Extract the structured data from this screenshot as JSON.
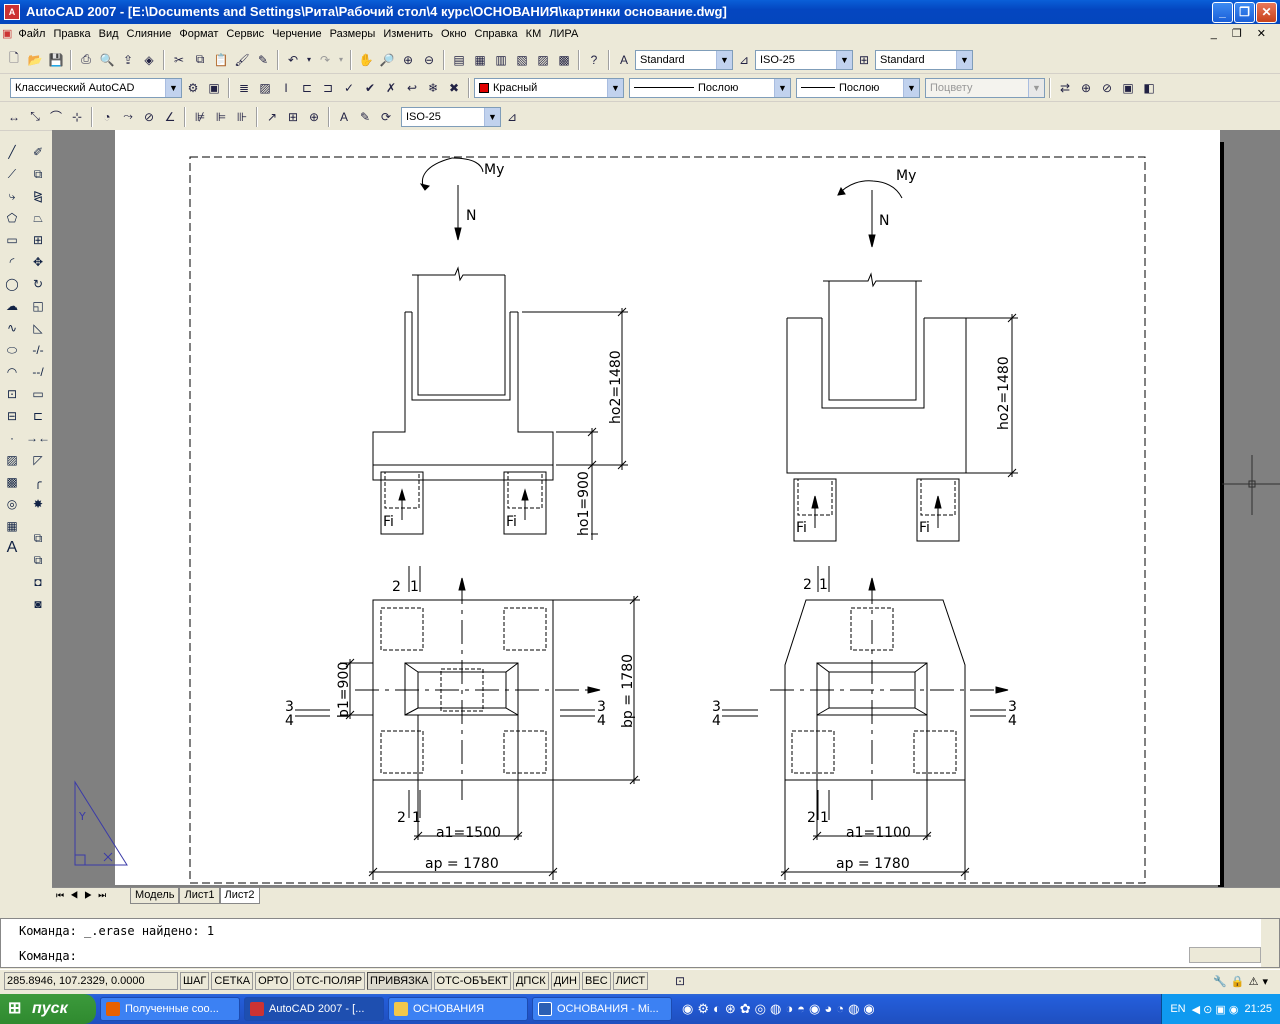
{
  "window": {
    "title": "AutoCAD 2007 - [E:\\Documents and Settings\\Рита\\Рабочий стол\\4 курс\\ОСНОВАНИЯ\\картинки основание.dwg]"
  },
  "menu": [
    "Файл",
    "Правка",
    "Вид",
    "Слияние",
    "Формат",
    "Сервис",
    "Черчение",
    "Размеры",
    "Изменить",
    "Окно",
    "Справка",
    "КМ",
    "ЛИРА"
  ],
  "styles": {
    "text_style": "Standard",
    "dim_style": "ISO-25",
    "table_style": "Standard"
  },
  "workspace": "Классический AutoCAD",
  "layer": {
    "color_name": "Красный",
    "linetype": "Послою",
    "lineweight": "Послою",
    "plotstyle": "Поцвету"
  },
  "dim_toolbar": {
    "style": "ISO-25"
  },
  "tabs": [
    "Модель",
    "Лист1",
    "Лист2"
  ],
  "command": {
    "line1": "Команда:  _.erase найдено: 1",
    "prompt": "Команда:"
  },
  "status": {
    "coords": "285.8946, 107.2329, 0.0000",
    "buttons": [
      "ШАГ",
      "СЕТКА",
      "ОРТО",
      "ОТС-ПОЛЯР",
      "ПРИВЯЗКА",
      "ОТС-ОБЪЕКТ",
      "ДПСК",
      "ДИН",
      "ВЕС",
      "ЛИСТ"
    ]
  },
  "taskbar": {
    "start": "пуск",
    "items": [
      "Полученные соо...",
      "AutoCAD 2007 - [...",
      "ОСНОВАНИЯ",
      "ОСНОВАНИЯ - Mi..."
    ],
    "lang": "EN",
    "time": "21:25"
  },
  "drawing": {
    "moment": "My",
    "force": "N",
    "pile_force": "Fi",
    "ho2": "ho2=1480",
    "ho1": "ho1=900",
    "b1": "b1=900",
    "bp": "bp = 1780",
    "a1_left": "a1=1500",
    "a1_right": "a1=1100",
    "ap": "ap = 1780",
    "sec1": "1",
    "sec2": "2",
    "sec3": "3",
    "sec4": "4",
    "ucs_y": "Y"
  }
}
